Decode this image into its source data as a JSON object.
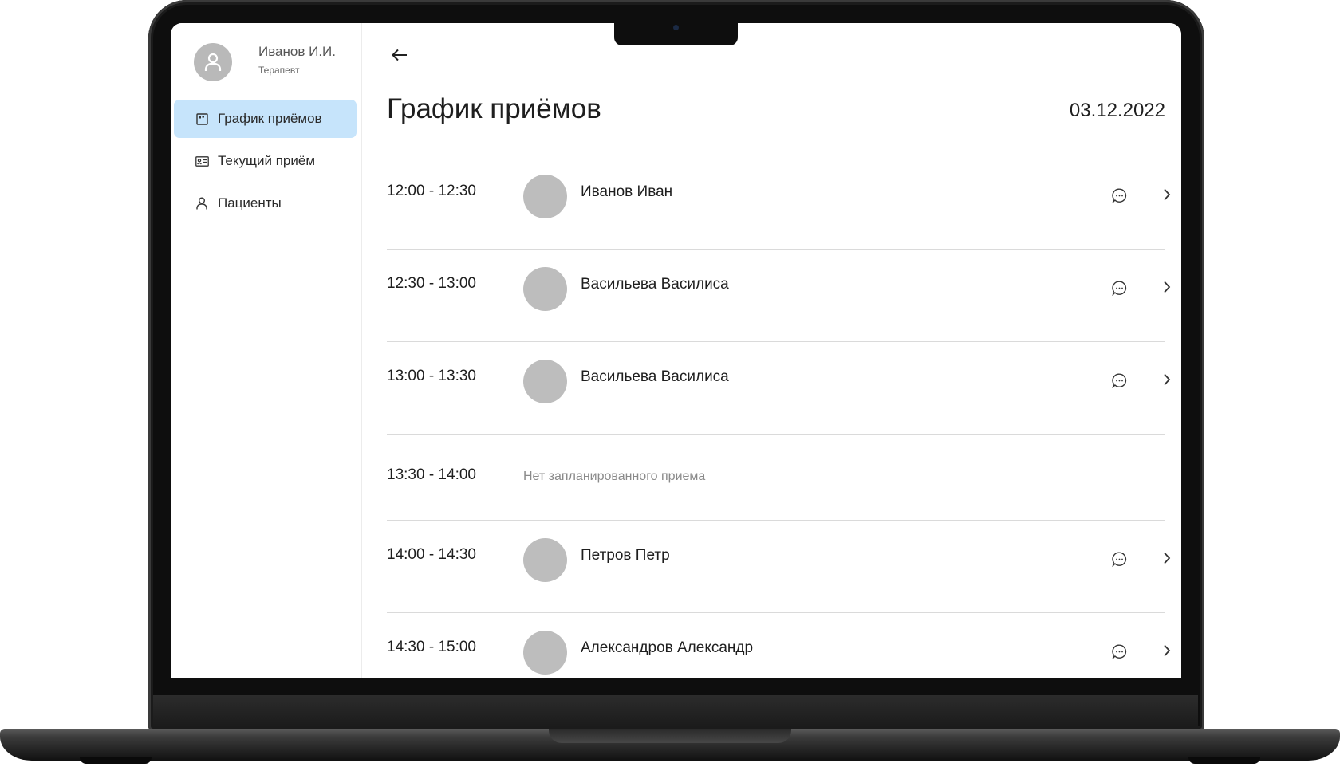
{
  "user": {
    "name": "Иванов И.И.",
    "role": "Терапевт"
  },
  "sidebar": {
    "items": [
      {
        "label": "График приёмов",
        "icon": "calendar-board-icon",
        "active": true
      },
      {
        "label": "Текущий приём",
        "icon": "id-card-icon",
        "active": false
      },
      {
        "label": "Пациенты",
        "icon": "person-icon",
        "active": false
      }
    ]
  },
  "header": {
    "title": "График приёмов",
    "date": "03.12.2022"
  },
  "appointments": [
    {
      "time": "12:00 - 12:30",
      "patient": "Иванов Иван"
    },
    {
      "time": "12:30 - 13:00",
      "patient": "Васильева Василиса"
    },
    {
      "time": "13:00 - 13:30",
      "patient": "Васильева Василиса"
    },
    {
      "time": "13:30 - 14:00",
      "empty_text": "Нет запланированного приема"
    },
    {
      "time": "14:00 - 14:30",
      "patient": "Петров Петр"
    },
    {
      "time": "14:30 - 15:00",
      "patient": "Александров Александр"
    }
  ],
  "colors": {
    "active_nav": "#c6e4fb",
    "avatar": "#bdbdbd",
    "divider": "#dadada"
  }
}
